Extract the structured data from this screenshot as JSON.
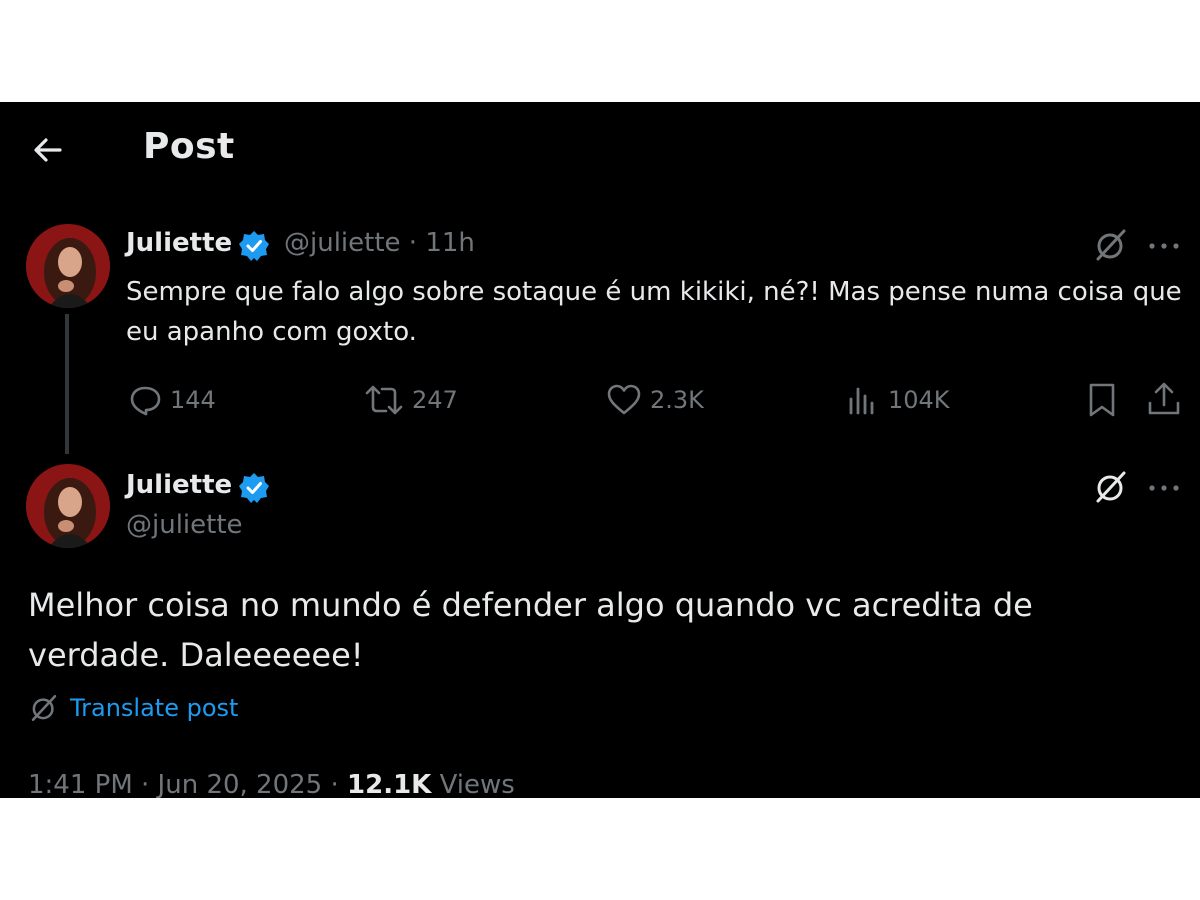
{
  "header": {
    "title": "Post",
    "back_icon": "arrow-left-icon"
  },
  "colors": {
    "background": "#000000",
    "text": "#e7e9ea",
    "muted": "#71767b",
    "accent": "#1d9bf0"
  },
  "parent_post": {
    "author_name": "Juliette",
    "handle": "@juliette",
    "separator": "·",
    "time": "11h",
    "text": "Sempre que falo algo sobre sotaque é um kikiki, né?! Mas pense numa coisa que eu apanho com goxto.",
    "actions": {
      "replies": "144",
      "reposts": "247",
      "likes": "2.3K",
      "views": "104K"
    }
  },
  "main_post": {
    "author_name": "Juliette",
    "handle": "@juliette",
    "text": "Melhor coisa no mundo é defender algo quando vc acredita de verdade. Daleeeeee!",
    "translate_label": "Translate post",
    "timestamp": "1:41 PM · Jun 20, 2025 ·",
    "views_count": "12.1K",
    "views_label": "Views"
  }
}
